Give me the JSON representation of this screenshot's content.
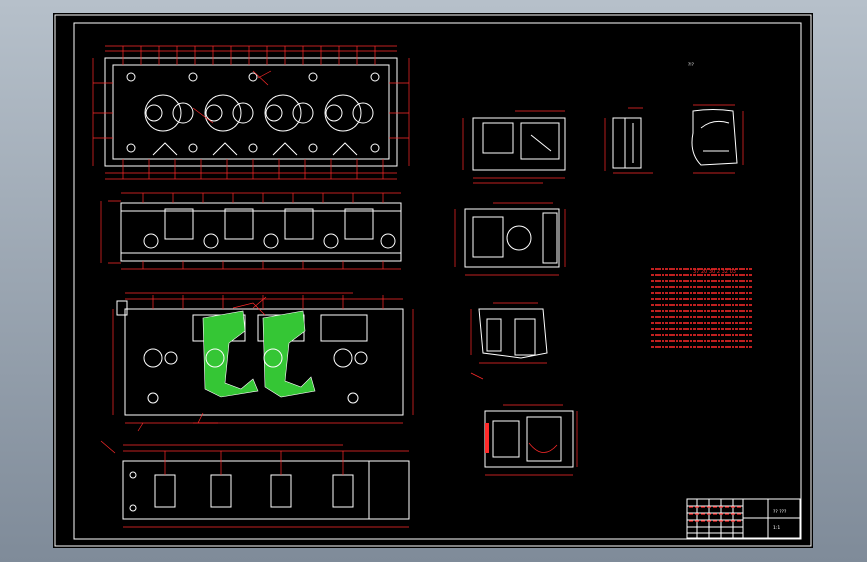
{
  "colors": {
    "background": "#000000",
    "outline": "#ffffff",
    "dimension": "#ff2a2a",
    "section_fill": "#35c635",
    "window_frame": "#8e9aa8"
  },
  "annotations": {
    "tiny_label": "?!?",
    "notes_fragment": "37 20 30 2 32 03",
    "title_block_name": "?? ???",
    "title_block_scale": "1:1"
  }
}
